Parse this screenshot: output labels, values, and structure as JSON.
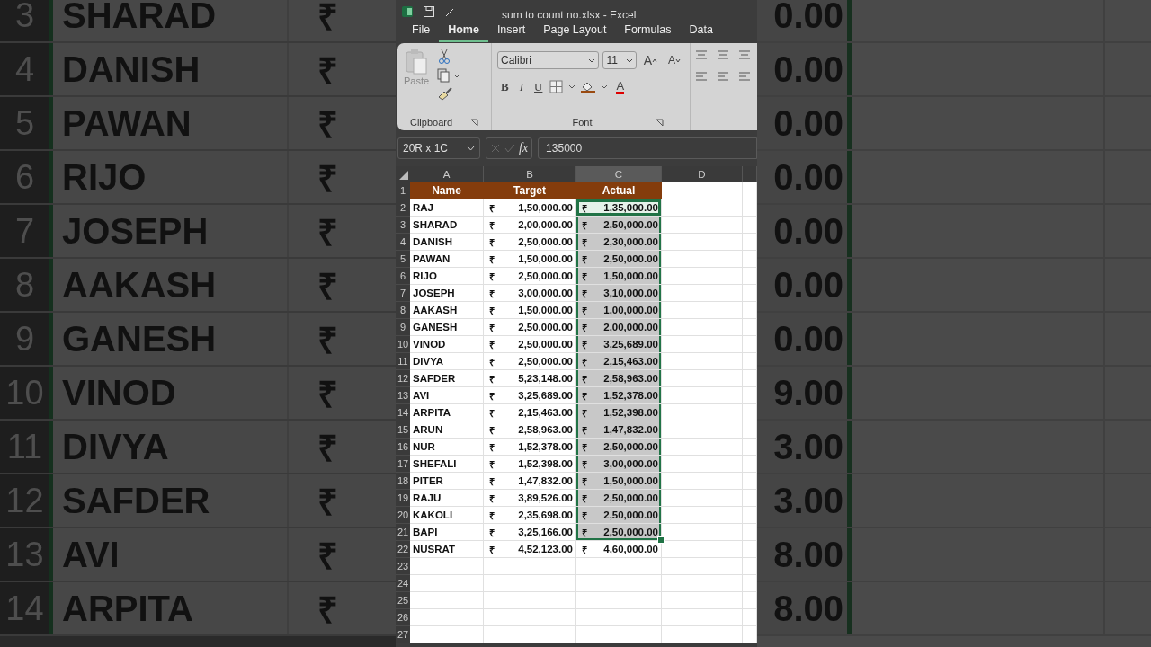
{
  "background_left": {
    "rows": [
      {
        "row": "3",
        "name": "SHARAD",
        "currency": "₹"
      },
      {
        "row": "4",
        "name": "DANISH",
        "currency": "₹"
      },
      {
        "row": "5",
        "name": "PAWAN",
        "currency": "₹"
      },
      {
        "row": "6",
        "name": "RIJO",
        "currency": "₹"
      },
      {
        "row": "7",
        "name": "JOSEPH",
        "currency": "₹"
      },
      {
        "row": "8",
        "name": "AAKASH",
        "currency": "₹"
      },
      {
        "row": "9",
        "name": "GANESH",
        "currency": "₹"
      },
      {
        "row": "10",
        "name": "VINOD",
        "currency": "₹"
      },
      {
        "row": "11",
        "name": "DIVYA",
        "currency": "₹"
      },
      {
        "row": "12",
        "name": "SAFDER",
        "currency": "₹"
      },
      {
        "row": "13",
        "name": "AVI",
        "currency": "₹"
      },
      {
        "row": "14",
        "name": "ARPITA",
        "currency": "₹"
      }
    ]
  },
  "window": {
    "title": "sum to count no.xlsx - Excel"
  },
  "ribbon_tabs": [
    {
      "label": "File",
      "selected": false
    },
    {
      "label": "Home",
      "selected": true
    },
    {
      "label": "Insert",
      "selected": false
    },
    {
      "label": "Page Layout",
      "selected": false
    },
    {
      "label": "Formulas",
      "selected": false
    },
    {
      "label": "Data",
      "selected": false
    }
  ],
  "ribbon": {
    "clipboard": {
      "paste": "Paste",
      "label": "Clipboard"
    },
    "font": {
      "family": "Calibri",
      "size": "11",
      "grow": "A",
      "shrink": "A",
      "bold": "B",
      "italic": "I",
      "underline": "U",
      "font_color": "A",
      "label": "Font"
    }
  },
  "formula_bar": {
    "name_box": "20R x 1C",
    "fx": "fx",
    "value": "135000"
  },
  "sheet": {
    "columns": [
      {
        "label": "A",
        "selected": false
      },
      {
        "label": "B",
        "selected": false
      },
      {
        "label": "C",
        "selected": true
      },
      {
        "label": "D",
        "selected": false
      }
    ],
    "rows": [
      {
        "row": "1",
        "kind": "header",
        "cells": [
          "Name",
          "Target",
          "Actual"
        ]
      },
      {
        "row": "2",
        "kind": "data",
        "name": "RAJ",
        "target_currency": "₹",
        "target": "1,50,000.00",
        "actual_currency": "₹",
        "actual": "1,35,000.00",
        "selected": true,
        "active": true
      },
      {
        "row": "3",
        "kind": "data",
        "name": "SHARAD",
        "target_currency": "₹",
        "target": "2,00,000.00",
        "actual_currency": "₹",
        "actual": "2,50,000.00",
        "selected": true,
        "active": false
      },
      {
        "row": "4",
        "kind": "data",
        "name": "DANISH",
        "target_currency": "₹",
        "target": "2,50,000.00",
        "actual_currency": "₹",
        "actual": "2,30,000.00",
        "selected": true,
        "active": false
      },
      {
        "row": "5",
        "kind": "data",
        "name": "PAWAN",
        "target_currency": "₹",
        "target": "1,50,000.00",
        "actual_currency": "₹",
        "actual": "2,50,000.00",
        "selected": true,
        "active": false
      },
      {
        "row": "6",
        "kind": "data",
        "name": "RIJO",
        "target_currency": "₹",
        "target": "2,50,000.00",
        "actual_currency": "₹",
        "actual": "1,50,000.00",
        "selected": true,
        "active": false
      },
      {
        "row": "7",
        "kind": "data",
        "name": "JOSEPH",
        "target_currency": "₹",
        "target": "3,00,000.00",
        "actual_currency": "₹",
        "actual": "3,10,000.00",
        "selected": true,
        "active": false
      },
      {
        "row": "8",
        "kind": "data",
        "name": "AAKASH",
        "target_currency": "₹",
        "target": "1,50,000.00",
        "actual_currency": "₹",
        "actual": "1,00,000.00",
        "selected": true,
        "active": false
      },
      {
        "row": "9",
        "kind": "data",
        "name": "GANESH",
        "target_currency": "₹",
        "target": "2,50,000.00",
        "actual_currency": "₹",
        "actual": "2,00,000.00",
        "selected": true,
        "active": false
      },
      {
        "row": "10",
        "kind": "data",
        "name": "VINOD",
        "target_currency": "₹",
        "target": "2,50,000.00",
        "actual_currency": "₹",
        "actual": "3,25,689.00",
        "selected": true,
        "active": false
      },
      {
        "row": "11",
        "kind": "data",
        "name": "DIVYA",
        "target_currency": "₹",
        "target": "2,50,000.00",
        "actual_currency": "₹",
        "actual": "2,15,463.00",
        "selected": true,
        "active": false
      },
      {
        "row": "12",
        "kind": "data",
        "name": "SAFDER",
        "target_currency": "₹",
        "target": "5,23,148.00",
        "actual_currency": "₹",
        "actual": "2,58,963.00",
        "selected": true,
        "active": false
      },
      {
        "row": "13",
        "kind": "data",
        "name": "AVI",
        "target_currency": "₹",
        "target": "3,25,689.00",
        "actual_currency": "₹",
        "actual": "1,52,378.00",
        "selected": true,
        "active": false
      },
      {
        "row": "14",
        "kind": "data",
        "name": "ARPITA",
        "target_currency": "₹",
        "target": "2,15,463.00",
        "actual_currency": "₹",
        "actual": "1,52,398.00",
        "selected": true,
        "active": false
      },
      {
        "row": "15",
        "kind": "data",
        "name": "ARUN",
        "target_currency": "₹",
        "target": "2,58,963.00",
        "actual_currency": "₹",
        "actual": "1,47,832.00",
        "selected": true,
        "active": false
      },
      {
        "row": "16",
        "kind": "data",
        "name": "NUR",
        "target_currency": "₹",
        "target": "1,52,378.00",
        "actual_currency": "₹",
        "actual": "2,50,000.00",
        "selected": true,
        "active": false
      },
      {
        "row": "17",
        "kind": "data",
        "name": "SHEFALI",
        "target_currency": "₹",
        "target": "1,52,398.00",
        "actual_currency": "₹",
        "actual": "3,00,000.00",
        "selected": true,
        "active": false
      },
      {
        "row": "18",
        "kind": "data",
        "name": "PITER",
        "target_currency": "₹",
        "target": "1,47,832.00",
        "actual_currency": "₹",
        "actual": "1,50,000.00",
        "selected": true,
        "active": false
      },
      {
        "row": "19",
        "kind": "data",
        "name": "RAJU",
        "target_currency": "₹",
        "target": "3,89,526.00",
        "actual_currency": "₹",
        "actual": "2,50,000.00",
        "selected": true,
        "active": false
      },
      {
        "row": "20",
        "kind": "data",
        "name": "KAKOLI",
        "target_currency": "₹",
        "target": "2,35,698.00",
        "actual_currency": "₹",
        "actual": "2,50,000.00",
        "selected": true,
        "active": false
      },
      {
        "row": "21",
        "kind": "data",
        "name": "BAPI",
        "target_currency": "₹",
        "target": "3,25,166.00",
        "actual_currency": "₹",
        "actual": "2,50,000.00",
        "selected": true,
        "active": false
      },
      {
        "row": "22",
        "kind": "data",
        "name": "NUSRAT",
        "target_currency": "₹",
        "target": "4,52,123.00",
        "actual_currency": "₹",
        "actual": "4,60,000.00",
        "selected": false,
        "active": false
      },
      {
        "row": "23",
        "kind": "empty"
      },
      {
        "row": "24",
        "kind": "empty"
      },
      {
        "row": "25",
        "kind": "empty"
      },
      {
        "row": "26",
        "kind": "empty"
      },
      {
        "row": "27",
        "kind": "empty"
      }
    ]
  },
  "background_right": {
    "rows": [
      {
        "amount": "0.00"
      },
      {
        "amount": "0.00"
      },
      {
        "amount": "0.00"
      },
      {
        "amount": "0.00"
      },
      {
        "amount": "0.00"
      },
      {
        "amount": "0.00"
      },
      {
        "amount": "0.00"
      },
      {
        "amount": "9.00"
      },
      {
        "amount": "3.00"
      },
      {
        "amount": "3.00"
      },
      {
        "amount": "8.00"
      },
      {
        "amount": "8.00"
      }
    ]
  }
}
